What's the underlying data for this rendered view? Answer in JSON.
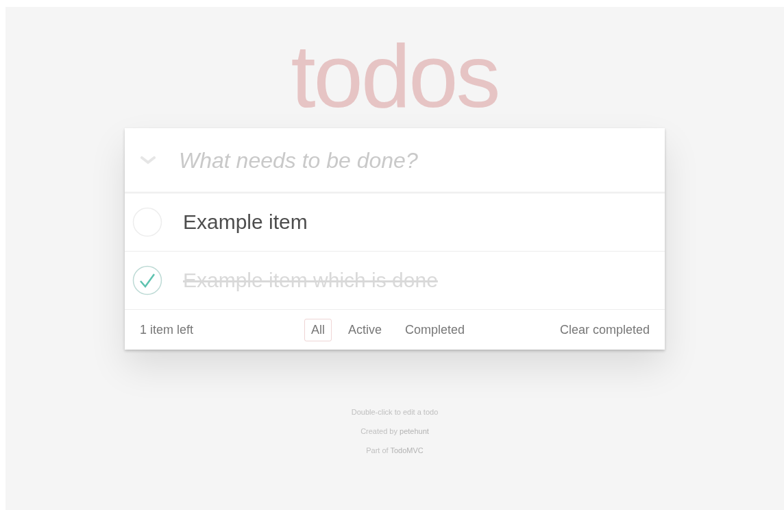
{
  "title": "todos",
  "new_todo": {
    "placeholder": "What needs to be done?"
  },
  "todos": [
    {
      "text": "Example item",
      "checked": false
    },
    {
      "text": "Example item which is done",
      "checked": true
    }
  ],
  "footer": {
    "count": "1 item left",
    "filters": [
      {
        "label": "All",
        "selected": true
      },
      {
        "label": "Active",
        "selected": false
      },
      {
        "label": "Completed",
        "selected": false
      }
    ],
    "clear": "Clear completed"
  },
  "info": [
    {
      "text": "Double-click to edit a todo"
    },
    {
      "text": "Created by ",
      "link": "petehunt"
    },
    {
      "text": "Part of ",
      "link": "TodoMVC"
    }
  ]
}
